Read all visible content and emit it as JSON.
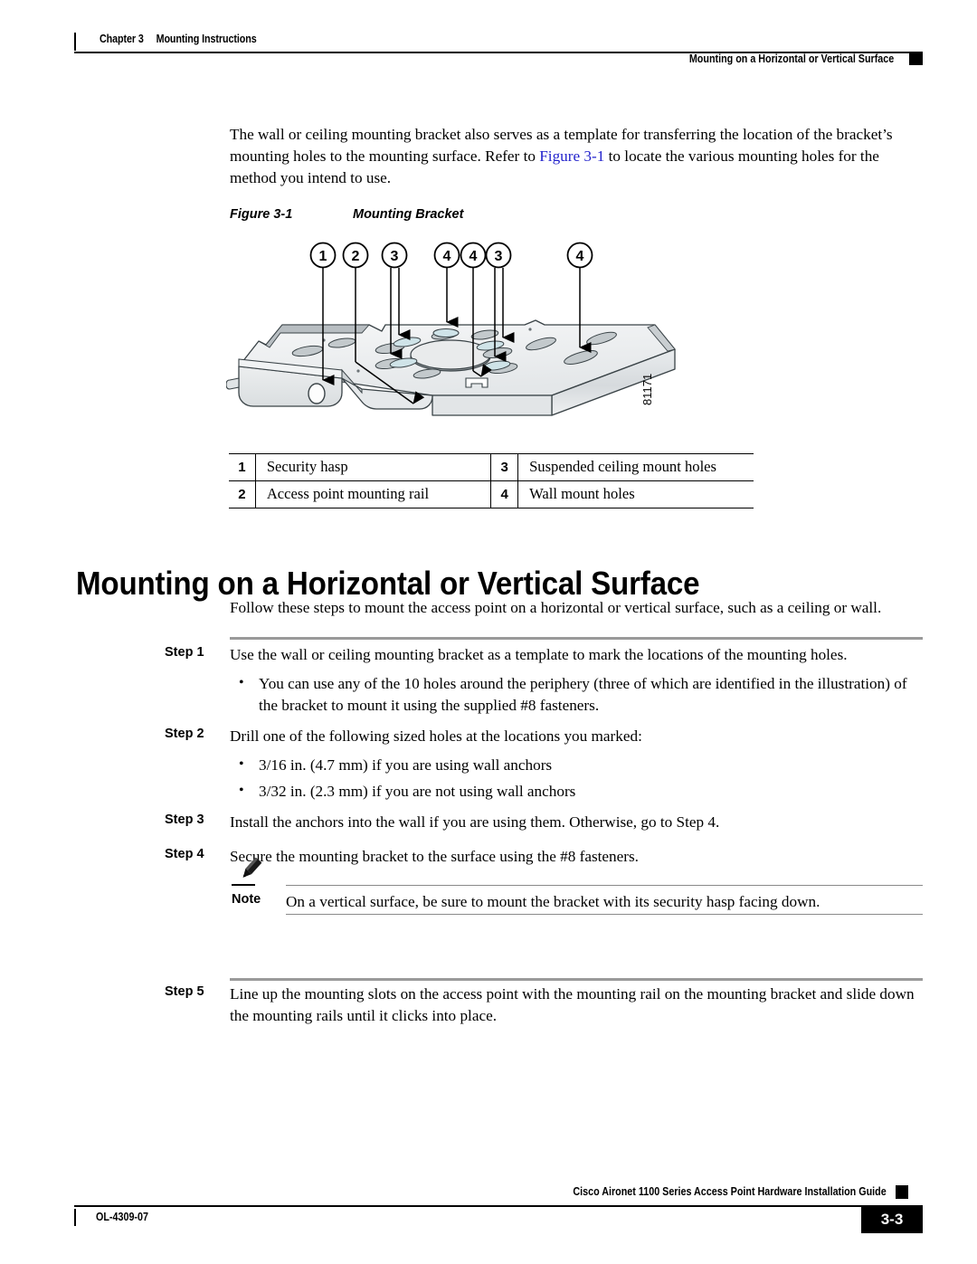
{
  "header": {
    "chapter_label": "Chapter 3",
    "chapter_title": "Mounting Instructions",
    "running_head": "Mounting on a Horizontal or Vertical Surface"
  },
  "intro_paragraph": {
    "text_before_link": "The wall or ceiling mounting bracket also serves as a template for transferring the location of the bracket’s mounting holes to the mounting surface. Refer to ",
    "link_text": "Figure 3-1",
    "text_after_link": " to locate the various mounting holes for the method you intend to use."
  },
  "figure": {
    "caption_number": "Figure 3-1",
    "caption_title": "Mounting Bracket",
    "artwork_id": "81171",
    "callouts": [
      "1",
      "2",
      "3",
      "4",
      "4",
      "3",
      "4"
    ],
    "legend": [
      {
        "num": "1",
        "text": "Security hasp",
        "num2": "3",
        "text2": "Suspended ceiling mount holes"
      },
      {
        "num": "2",
        "text": "Access point mounting rail",
        "num2": "4",
        "text2": "Wall mount holes"
      }
    ]
  },
  "section": {
    "heading": "Mounting on a Horizontal or Vertical Surface",
    "intro": "Follow these steps to mount the access point on a horizontal or vertical surface, such as a ceiling or wall.",
    "steps": [
      {
        "label": "Step 1",
        "text": "Use the wall or ceiling mounting bracket as a template to mark the locations of the mounting holes.",
        "bullets": [
          "You can use any of the 10 holes around the periphery (three of which are identified in the illustration) of the bracket to mount it using the supplied #8 fasteners."
        ]
      },
      {
        "label": "Step 2",
        "text": "Drill one of the following sized holes at the locations you marked:",
        "bullets": [
          "3/16 in. (4.7 mm) if you are using wall anchors",
          "3/32 in. (2.3 mm) if you are not using wall anchors"
        ]
      },
      {
        "label": "Step 3",
        "text": "Install the anchors into the wall if you are using them. Otherwise, go to Step 4.",
        "bullets": []
      },
      {
        "label": "Step 4",
        "text": "Secure the mounting bracket to the surface using the #8 fasteners.",
        "bullets": []
      },
      {
        "label": "Step 5",
        "text": "Line up the mounting slots on the access point with the mounting rail on the mounting bracket and slide down the mounting rails until it clicks into place.",
        "bullets": []
      }
    ]
  },
  "note": {
    "label": "Note",
    "text": "On a vertical surface, be sure to mount the bracket with its security hasp facing down."
  },
  "footer": {
    "guide_title": "Cisco Aironet 1100 Series Access Point Hardware Installation Guide",
    "doc_id": "OL-4309-07",
    "page_number": "3-3"
  },
  "colors": {
    "link": "#2222cc",
    "rule_gray": "#9a9a9a",
    "metal_light": "#f2f3f4",
    "metal_mid": "#dcdfe1",
    "metal_dark": "#b9bec1"
  }
}
